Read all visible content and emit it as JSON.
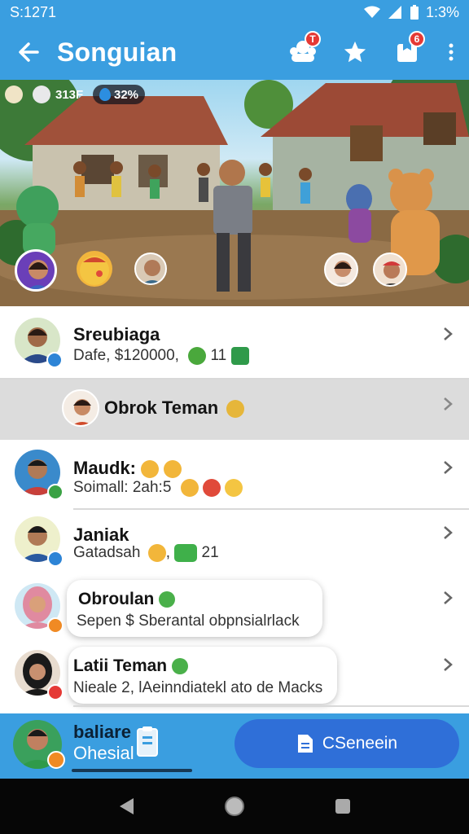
{
  "status_bar": {
    "time": "S:1271",
    "battery": "1:3%"
  },
  "app_bar": {
    "title": "Songuian",
    "notif_badge": "T",
    "inbox_badge": "6"
  },
  "hud": {
    "coins": "313F",
    "gems": "32%"
  },
  "scene": {
    "progress": 0.46
  },
  "list": [
    {
      "name": "Sreubiaga",
      "sub": "Dafe, $120000,",
      "count": "11"
    },
    {
      "name": "Obrok Teman"
    },
    {
      "name": "Maudk:",
      "sub": "Soimall: 2ah:5"
    },
    {
      "name": "Janiak",
      "sub": "Gatadsah",
      "sub2": ",",
      "count": "21"
    },
    {
      "name": "Obroulan",
      "sub": "Sepen $ Sberantal obpnsialrlack"
    },
    {
      "name": "Latii Teman",
      "sub": "Nieale 2, lAeinndiatekl ato de Macks"
    }
  ],
  "bottom": {
    "user_name": "baliare",
    "user_status": "Ohesial",
    "cta_label": "CSeneein"
  },
  "colors": {
    "primary": "#3a9ee0",
    "cta": "#2f6fd8",
    "nav": "#060606"
  }
}
